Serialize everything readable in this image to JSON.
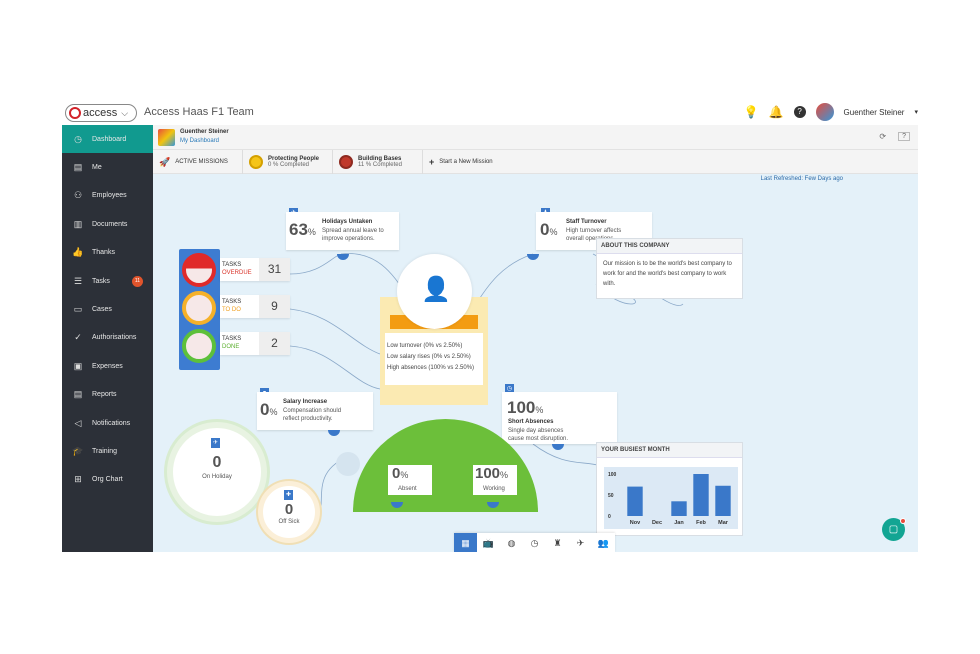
{
  "topbar": {
    "brand": "access",
    "team": "Access Haas F1 Team",
    "user": "Guenther Steiner",
    "icons": [
      "lightbulb-icon",
      "bell-icon",
      "help-icon",
      "caret-down-icon"
    ]
  },
  "sidebar": {
    "items": [
      {
        "label": "Dashboard",
        "icon": "clock-icon",
        "active": true
      },
      {
        "label": "Me",
        "icon": "id-card-icon"
      },
      {
        "label": "Employees",
        "icon": "people-icon"
      },
      {
        "label": "Documents",
        "icon": "documents-icon"
      },
      {
        "label": "Thanks",
        "icon": "thumbs-up-icon"
      },
      {
        "label": "Tasks",
        "icon": "tasks-icon",
        "badge": "11"
      },
      {
        "label": "Cases",
        "icon": "folder-icon"
      },
      {
        "label": "Authorisations",
        "icon": "check-icon"
      },
      {
        "label": "Expenses",
        "icon": "money-icon"
      },
      {
        "label": "Reports",
        "icon": "report-icon"
      },
      {
        "label": "Notifications",
        "icon": "megaphone-icon"
      },
      {
        "label": "Training",
        "icon": "graduation-cap-icon"
      },
      {
        "label": "Org Chart",
        "icon": "org-chart-icon"
      }
    ]
  },
  "profile": {
    "name": "Guenther Steiner",
    "link": "My Dashboard",
    "refresh": "⟳",
    "help": "?"
  },
  "missions": {
    "active_label": "ACTIVE MISSIONS",
    "items": [
      {
        "title": "Protecting People",
        "sub": "0 % Completed"
      },
      {
        "title": "Building Bases",
        "sub": "11 % Completed"
      }
    ],
    "new_label": "Start a New Mission"
  },
  "refreshed": "Last Refreshed: Few Days ago",
  "holidays": {
    "value": "63",
    "unit": "%",
    "title": "Holidays Untaken",
    "text": [
      "Spread annual leave to",
      "improve operations."
    ]
  },
  "turnover": {
    "value": "0",
    "unit": "%",
    "title": "Staff Turnover",
    "text": [
      "High turnover affects",
      "overall operations."
    ]
  },
  "about": {
    "title": "ABOUT THIS COMPANY",
    "text": "Our mission is to be the world's best company to work for and the world's best company to work with."
  },
  "tasks": [
    {
      "label": "TASKS",
      "status": "OVERDUE",
      "count": "31",
      "status_color": "#d9342b",
      "light": "#e02a2a"
    },
    {
      "label": "TASKS",
      "status": "TO DO",
      "count": "9",
      "status_color": "#f0a020",
      "light": "#f5b12a"
    },
    {
      "label": "TASKS",
      "status": "DONE",
      "count": "2",
      "status_color": "#5cb030",
      "light": "#5dc03a"
    }
  ],
  "stats": {
    "title": "YOUR STATS",
    "lines": [
      "Low turnover (0% vs 2.50%)",
      "Low salary rises (0% vs 2.50%)",
      "High absences (100% vs 2.50%)"
    ]
  },
  "salary": {
    "value": "0",
    "unit": "%",
    "title": "Salary Increase",
    "text": [
      "Compensation should",
      "reflect productivity."
    ]
  },
  "absences": {
    "value": "100",
    "unit": "%",
    "title": "Short Absences",
    "text": [
      "Single day absences",
      "cause most disruption."
    ]
  },
  "attendance": {
    "absent": {
      "value": "0",
      "unit": "%",
      "label": "Absent"
    },
    "working": {
      "value": "100",
      "unit": "%",
      "label": "Working"
    }
  },
  "rings": {
    "holiday": {
      "value": "0",
      "label": "On Holiday"
    },
    "sick": {
      "value": "0",
      "label": "Off Sick"
    }
  },
  "busiest": {
    "title": "YOUR BUSIEST MONTH"
  },
  "chart_data": {
    "type": "bar",
    "categories": [
      "Nov",
      "Dec",
      "Jan",
      "Feb",
      "Mar"
    ],
    "values": [
      70,
      0,
      35,
      100,
      72
    ],
    "yticks": [
      "100",
      "50",
      "0"
    ],
    "ylim": [
      0,
      100
    ],
    "color": "#3a78c9"
  },
  "bottom_nav": [
    "grid-icon",
    "tv-icon",
    "globe-icon",
    "clock-icon",
    "rocket-icon",
    "plane-icon",
    "team-icon"
  ],
  "chat_icon": "chat-icon"
}
